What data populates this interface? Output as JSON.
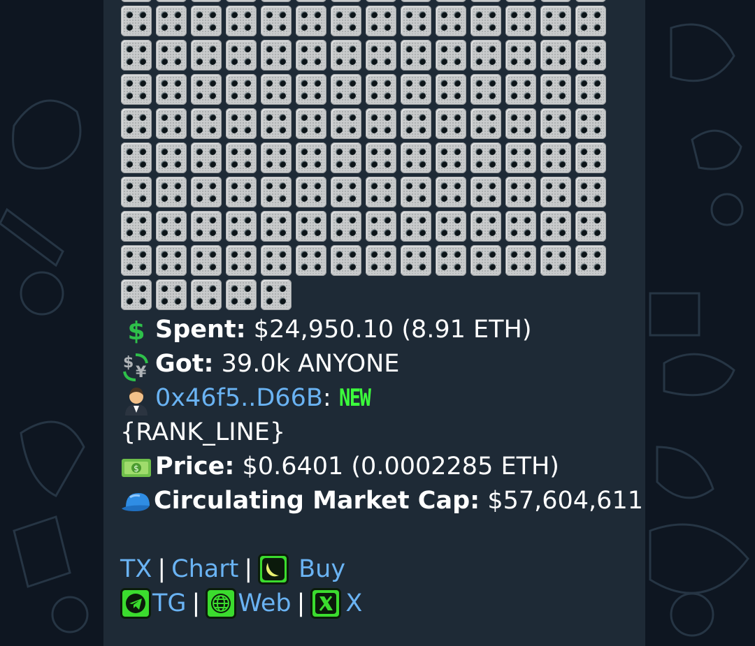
{
  "message": {
    "dice_count": 131,
    "spent": {
      "label": "Spent:",
      "value": "$24,950.10 (8.91 ETH)",
      "icon": "dollar-sign-icon"
    },
    "got": {
      "label": "Got:",
      "value": "39.0k ANYONE",
      "icon": "currency-exchange-icon"
    },
    "wallet": {
      "address": "0x46f5..D66B",
      "colon": ":",
      "badge": "NEW",
      "icon": "man-in-tuxedo-icon"
    },
    "rank_line": "{RANK_LINE}",
    "price": {
      "label": "Price:",
      "value": "$0.6401 (0.0002285 ETH)",
      "icon": "dollar-banknote-icon"
    },
    "market_cap": {
      "label": "Circulating Market Cap:",
      "value": "$57,604,611",
      "icon": "blue-cap-icon"
    }
  },
  "links": {
    "tx": "TX",
    "chart": "Chart",
    "buy": "Buy",
    "tg": "TG",
    "web": "Web",
    "x": "X",
    "separator": "|"
  },
  "colors": {
    "background": "#0e1621",
    "bubble": "#1e2a36",
    "link": "#6ab3f3",
    "badge_green": "#3cff3c"
  }
}
